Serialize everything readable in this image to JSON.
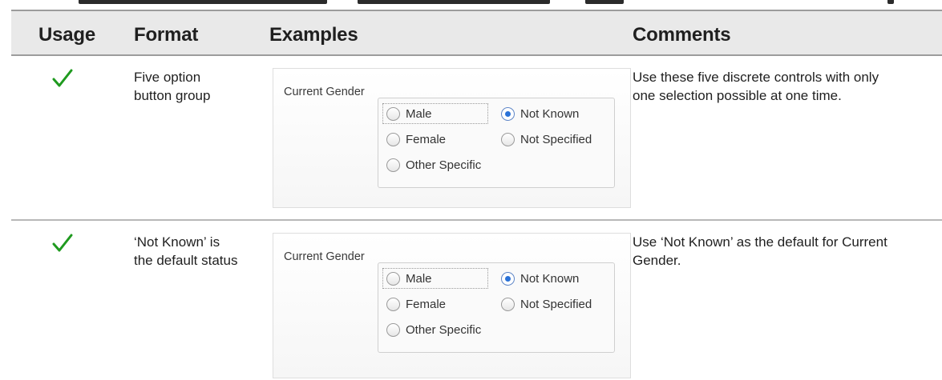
{
  "header": {
    "usage": "Usage",
    "format": "Format",
    "examples": "Examples",
    "comments": "Comments"
  },
  "rows": [
    {
      "usage_icon": "check-icon",
      "format_lines": [
        "Five option",
        "button group"
      ],
      "comment_lines": [
        "Use these five discrete controls with only",
        "one selection possible at one time."
      ],
      "example": {
        "label": "Current Gender",
        "options": {
          "male": "Male",
          "not_known": "Not Known",
          "female": "Female",
          "not_specified": "Not Specified",
          "other_specific": "Other Specific"
        },
        "selected": "Not Known"
      }
    },
    {
      "usage_icon": "check-icon",
      "format_lines": [
        "‘Not Known’ is",
        "the default status"
      ],
      "comment_lines": [
        "Use ‘Not Known’ as the default for Current",
        "Gender."
      ],
      "example": {
        "label": "Current Gender",
        "options": {
          "male": "Male",
          "not_known": "Not Known",
          "female": "Female",
          "not_specified": "Not Specified",
          "other_specific": "Other Specific"
        },
        "selected": "Not Known"
      }
    }
  ],
  "colors": {
    "check": "#1f9a1f",
    "header_bg": "#e9e9e9",
    "radio_selected": "#2a72d8"
  }
}
